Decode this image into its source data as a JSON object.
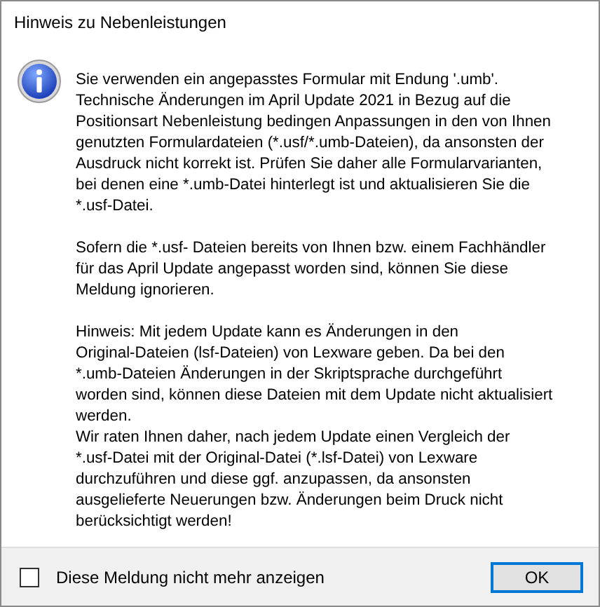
{
  "window": {
    "title": "Hinweis zu Nebenleistungen"
  },
  "message": [
    [
      [
        "Sie verwenden ein angepasstes Formular mit Endung '.umb'.",
        "Technische Änderungen im April Update 2021 in Bezug auf die",
        "Positionsart Nebenleistung bedingen Anpassungen in den von Ihnen",
        "genutzten Formulardateien (*.usf/*.umb-Dateien), da ansonsten der",
        "Ausdruck nicht korrekt ist. Prüfen Sie daher alle Formularvarianten,",
        "bei denen eine *.umb-Datei hinterlegt ist und aktualisieren Sie die",
        "*.usf-Datei."
      ]
    ],
    [
      [
        "Sofern die *.usf- Dateien bereits von Ihnen bzw. einem Fachhändler",
        "für das April Update angepasst worden sind, können Sie diese",
        "Meldung ignorieren."
      ]
    ],
    [
      [
        "Hinweis: Mit jedem Update kann es Änderungen in den",
        "Original-Dateien (lsf-Dateien) von Lexware geben. Da bei den",
        "*.umb-Dateien Änderungen in der Skriptsprache durchgeführt",
        "worden sind, können diese Dateien mit dem Update nicht aktualisiert",
        "werden."
      ],
      [
        "Wir raten Ihnen daher, nach jedem Update einen Vergleich der",
        "*.usf-Datei mit der Original-Datei (*.lsf-Datei) von Lexware",
        "durchzuführen und diese ggf. anzupassen, da ansonsten",
        "ausgelieferte Neuerungen bzw. Änderungen beim Druck nicht",
        "berücksichtigt werden!"
      ]
    ]
  ],
  "checkbox": {
    "label": "Diese Meldung nicht mehr anzeigen",
    "checked": false
  },
  "ok_button": {
    "label": "OK",
    "focused": true
  }
}
